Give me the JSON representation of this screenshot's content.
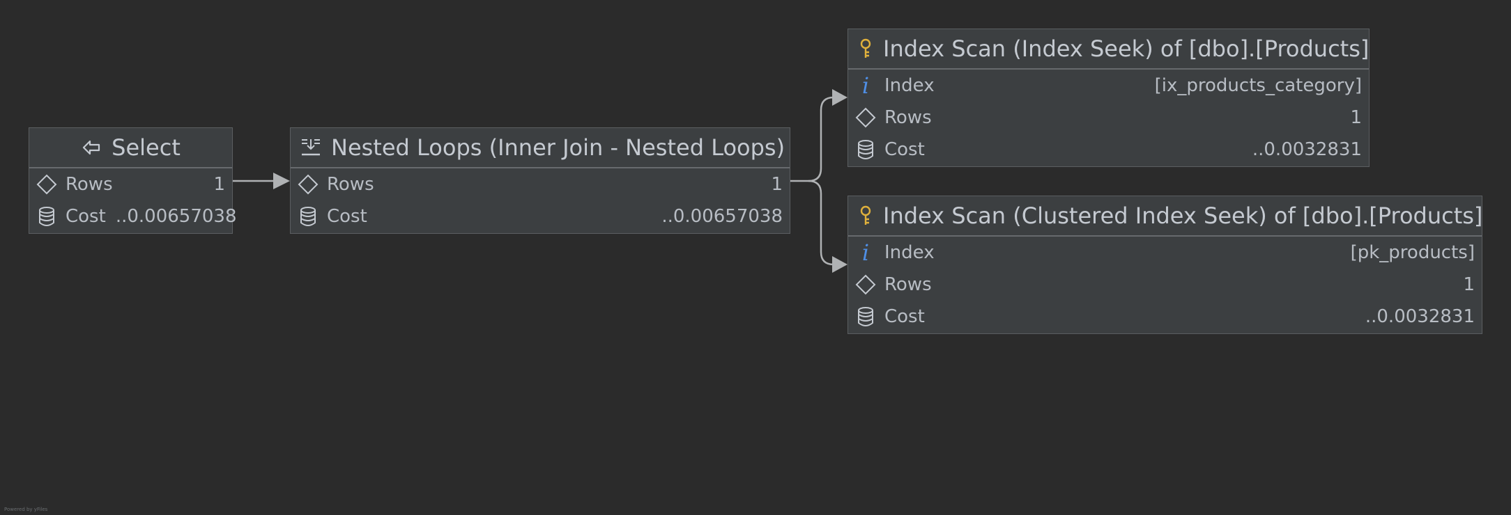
{
  "nodes": {
    "select": {
      "title": "Select",
      "icon": "arrow-left-icon",
      "rows": [
        {
          "label": "Rows",
          "value": "1",
          "icon": "diamond-icon"
        },
        {
          "label": "Cost",
          "value": "..0.00657038",
          "icon": "database-icon"
        }
      ]
    },
    "nested_loops": {
      "title": "Nested Loops (Inner Join - Nested Loops)",
      "icon": "nested-loops-icon",
      "rows": [
        {
          "label": "Rows",
          "value": "1",
          "icon": "diamond-icon"
        },
        {
          "label": "Cost",
          "value": "..0.00657038",
          "icon": "database-icon"
        }
      ]
    },
    "index_seek": {
      "title": "Index Scan (Index Seek) of [dbo].[Products]",
      "icon": "key-icon",
      "rows": [
        {
          "label": "Index",
          "value": "[ix_products_category]",
          "icon": "info-icon"
        },
        {
          "label": "Rows",
          "value": "1",
          "icon": "diamond-icon"
        },
        {
          "label": "Cost",
          "value": "..0.0032831",
          "icon": "database-icon"
        }
      ]
    },
    "clustered_seek": {
      "title": "Index Scan (Clustered Index Seek) of [dbo].[Products]",
      "icon": "key-icon",
      "rows": [
        {
          "label": "Index",
          "value": "[pk_products]",
          "icon": "info-icon"
        },
        {
          "label": "Rows",
          "value": "1",
          "icon": "diamond-icon"
        },
        {
          "label": "Cost",
          "value": "..0.0032831",
          "icon": "database-icon"
        }
      ]
    }
  },
  "colors": {
    "background": "#2b2b2b",
    "node_fill": "#3c3f41",
    "key_icon": "#e0b13c",
    "info_icon": "#4f8fe6",
    "edge": "#a9abad"
  },
  "footer": "Powered by yFiles"
}
